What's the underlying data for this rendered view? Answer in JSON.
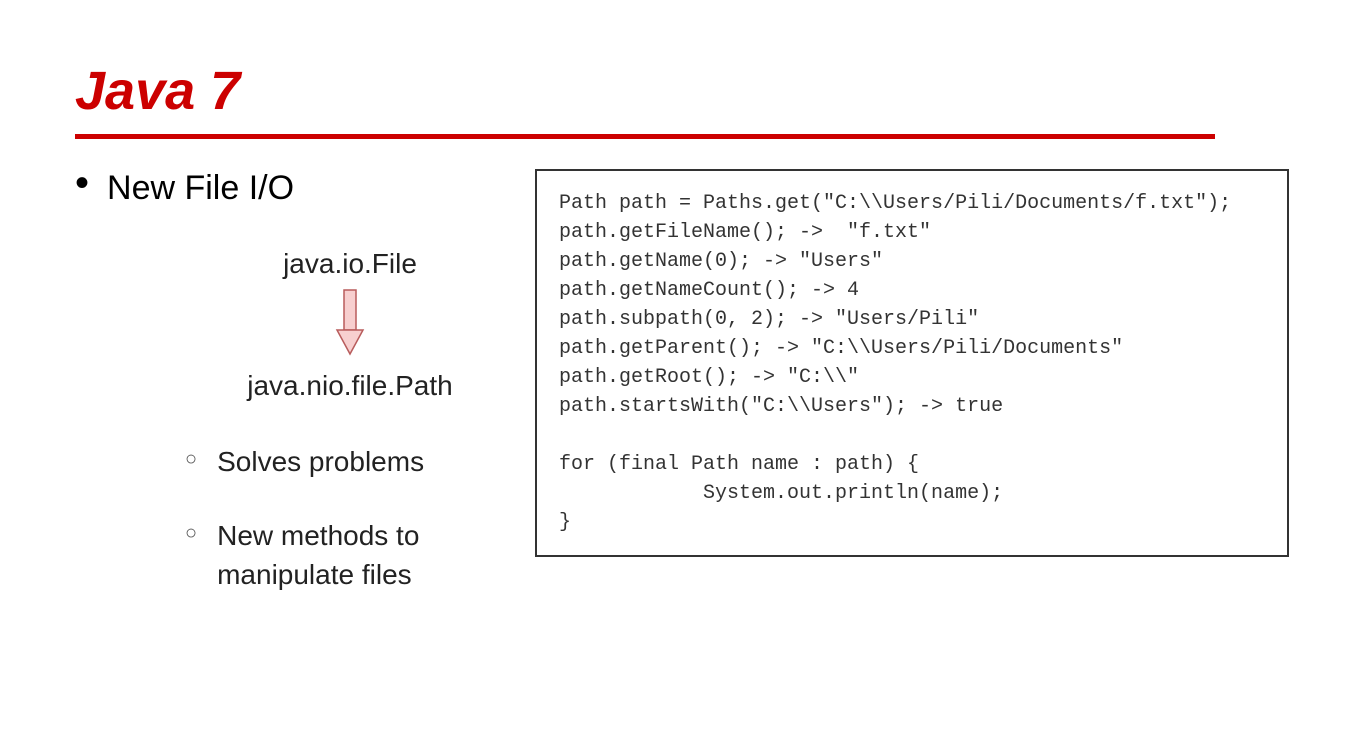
{
  "title": "Java 7",
  "main_bullet": "New File I/O",
  "diagram": {
    "top_text": "java.io.File",
    "bottom_text": "java.nio.file.Path"
  },
  "sub_bullets": [
    "Solves problems",
    "New methods to manipulate files"
  ],
  "code": "Path path = Paths.get(\"C:\\\\Users/Pili/Documents/f.txt\");\npath.getFileName(); ->  \"f.txt\"\npath.getName(0); -> \"Users\"\npath.getNameCount(); -> 4\npath.subpath(0, 2); -> \"Users/Pili\"\npath.getParent(); -> \"C:\\\\Users/Pili/Documents\"\npath.getRoot(); -> \"C:\\\\\"\npath.startsWith(\"C:\\\\Users\"); -> true\n\nfor (final Path name : path) {\n            System.out.println(name);\n}"
}
